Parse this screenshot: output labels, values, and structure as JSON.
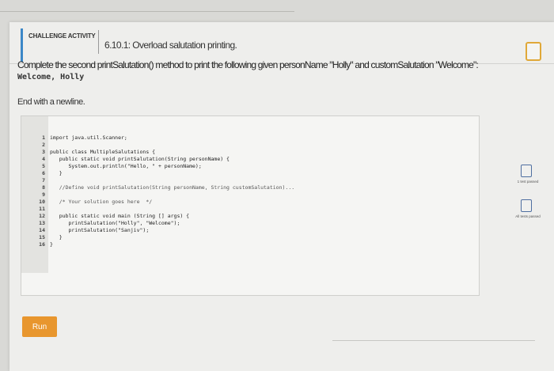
{
  "header": {
    "challenge_label": "CHALLENGE ACTIVITY",
    "activity_title": "6.10.1: Overload salutation printing."
  },
  "instructions": {
    "text": "Complete the second printSalutation() method to print the following given personName \"Holly\" and customSalutation \"Welcome\":",
    "sample_output": "Welcome, Holly",
    "end_note": "End with a newline."
  },
  "code": {
    "lines": [
      {
        "n": "1",
        "text": "import java.util.Scanner;"
      },
      {
        "n": "2",
        "text": ""
      },
      {
        "n": "3",
        "text": "public class MultipleSalutations {"
      },
      {
        "n": "4",
        "text": "   public static void printSalutation(String personName) {"
      },
      {
        "n": "5",
        "text": "      System.out.println(\"Hello, \" + personName);"
      },
      {
        "n": "6",
        "text": "   }"
      },
      {
        "n": "7",
        "text": ""
      },
      {
        "n": "8",
        "text": "   //Define void printSalutation(String personName, String customSalutation)..."
      },
      {
        "n": "9",
        "text": ""
      },
      {
        "n": "10",
        "text": "   /* Your solution goes here  */"
      },
      {
        "n": "11",
        "text": ""
      },
      {
        "n": "12",
        "text": "   public static void main (String [] args) {"
      },
      {
        "n": "13",
        "text": "      printSalutation(\"Holly\", \"Welcome\");"
      },
      {
        "n": "14",
        "text": "      printSalutation(\"Sanjiv\");"
      },
      {
        "n": "15",
        "text": "   }"
      },
      {
        "n": "16",
        "text": "}"
      }
    ]
  },
  "actions": {
    "run_label": "Run"
  },
  "tests": {
    "first": "1 test passed",
    "all": "All tests passed"
  },
  "colors": {
    "accent": "#3b87c7",
    "completion_border": "#e0a838",
    "run_button": "#e8962e",
    "test_box": "#4e6ea0"
  }
}
